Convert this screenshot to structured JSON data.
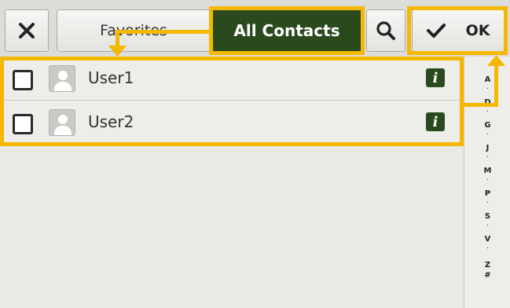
{
  "toolbar": {
    "close_icon": "x-icon",
    "tabs": [
      {
        "label": "Favorites",
        "selected": false
      },
      {
        "label": "All Contacts",
        "selected": true
      }
    ],
    "search_icon": "search-icon",
    "ok_label": "OK",
    "ok_icon": "check-icon"
  },
  "contacts": [
    {
      "name": "User1",
      "checked": false,
      "info_label": "i"
    },
    {
      "name": "User2",
      "checked": false,
      "info_label": "i"
    }
  ],
  "index": {
    "letters": [
      "A",
      "D",
      "G",
      "J",
      "M",
      "P",
      "S",
      "V",
      "Z",
      "#"
    ],
    "separator": "·"
  },
  "colors": {
    "accent_dark_green": "#2a4a1e",
    "annotation_yellow": "#f5b800",
    "background": "#e9e9e6"
  }
}
